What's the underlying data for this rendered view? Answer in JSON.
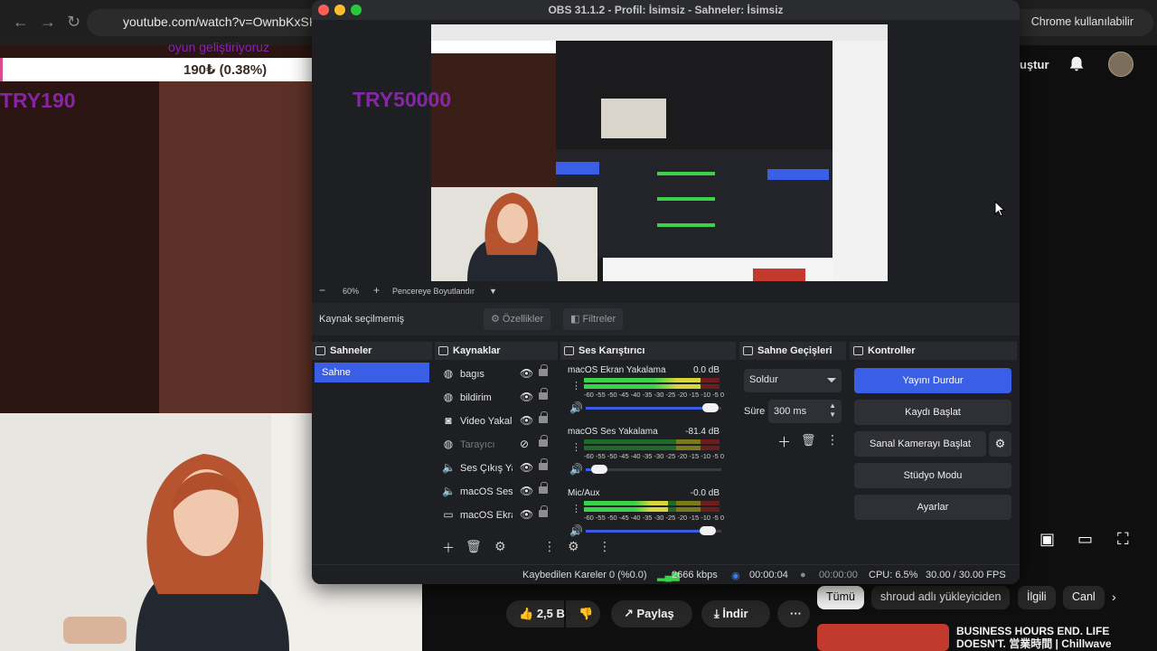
{
  "browser": {
    "url": "youtube.com/watch?v=OwnbKxSKN",
    "chrome_notice": "Chrome kullanılabilir"
  },
  "stream_overlay": {
    "subtitle": "oyun geliştiriyoruz",
    "donation": "190₺ (0.38%)",
    "amount_left": "TRY190",
    "amount_right": "TRY50000"
  },
  "youtube": {
    "create_label": "uştur",
    "actions": {
      "likes": "2,5 B",
      "share": "Paylaş",
      "download": "İndir",
      "more": "···"
    },
    "chips": [
      "Tümü",
      "shroud adlı yükleyiciden",
      "İlgili",
      "Canl"
    ],
    "recommended_title": "BUSINESS HOURS END. LIFE DOESN'T. 営業時間 | Chillwave"
  },
  "obs": {
    "title": "OBS 31.1.2 - Profil: İsimsiz - Sahneler: İsimsiz",
    "zoom": {
      "minus": "−",
      "value": "60%",
      "plus": "+",
      "fit_label": "Pencereye Boyutlandır"
    },
    "props": {
      "no_source": "Kaynak seçilmemiş",
      "properties": "Özellikler",
      "filters": "Filtreler"
    },
    "docks": {
      "scenes": "Sahneler",
      "sources": "Kaynaklar",
      "mixer": "Ses Karıştırıcı",
      "transitions": "Sahne Geçişleri",
      "controls": "Kontroller"
    },
    "scenes": [
      "Sahne"
    ],
    "sources": [
      {
        "name": "bagıs",
        "icon": "globe-icon",
        "glyph": "◍",
        "visible": true
      },
      {
        "name": "bildirim",
        "icon": "globe-icon",
        "glyph": "◍",
        "visible": true
      },
      {
        "name": "Video Yakalama",
        "icon": "camera-icon",
        "glyph": "◙",
        "visible": true
      },
      {
        "name": "Tarayıcı",
        "icon": "globe-icon",
        "glyph": "◍",
        "visible": false
      },
      {
        "name": "Ses Çıkış Yakalama",
        "icon": "speaker-icon",
        "glyph": "🔈",
        "visible": true
      },
      {
        "name": "macOS Ses Yakalama",
        "icon": "speaker-icon",
        "glyph": "🔈",
        "visible": true
      },
      {
        "name": "macOS Ekran Yakalama",
        "icon": "monitor-icon",
        "glyph": "▭",
        "visible": true
      }
    ],
    "mixer": [
      {
        "name": "macOS Ekran Yakalama",
        "db": "0.0 dB",
        "level": 0.86,
        "volume": 0.92
      },
      {
        "name": "macOS Ses Yakalama",
        "db": "-81.4 dB",
        "level": 0.0,
        "volume": 0.1
      },
      {
        "name": "Mic/Aux",
        "db": "-0.0 dB",
        "level": 0.62,
        "volume": 0.9
      }
    ],
    "meter_scale": "-60 -55 -50 -45 -40 -35 -30 -25 -20 -15 -10 -5 0",
    "transitions": {
      "selected": "Soldur",
      "duration_label": "Süre",
      "duration_value": "300 ms"
    },
    "controls": {
      "stop_stream": "Yayını Durdur",
      "start_record": "Kaydı Başlat",
      "virtual_cam": "Sanal Kamerayı Başlat",
      "studio_mode": "Stüdyo Modu",
      "settings": "Ayarlar"
    },
    "status": {
      "dropped": "Kaybedilen Kareler 0 (%0.0)",
      "bitrate": "2666 kbps",
      "stream_time": "00:00:04",
      "record_time": "00:00:00",
      "cpu": "CPU: 6.5%",
      "fps": "30.00 / 30.00 FPS"
    }
  },
  "colors": {
    "accent": "#3b5ee6",
    "meter_green": "#3bd14a"
  }
}
